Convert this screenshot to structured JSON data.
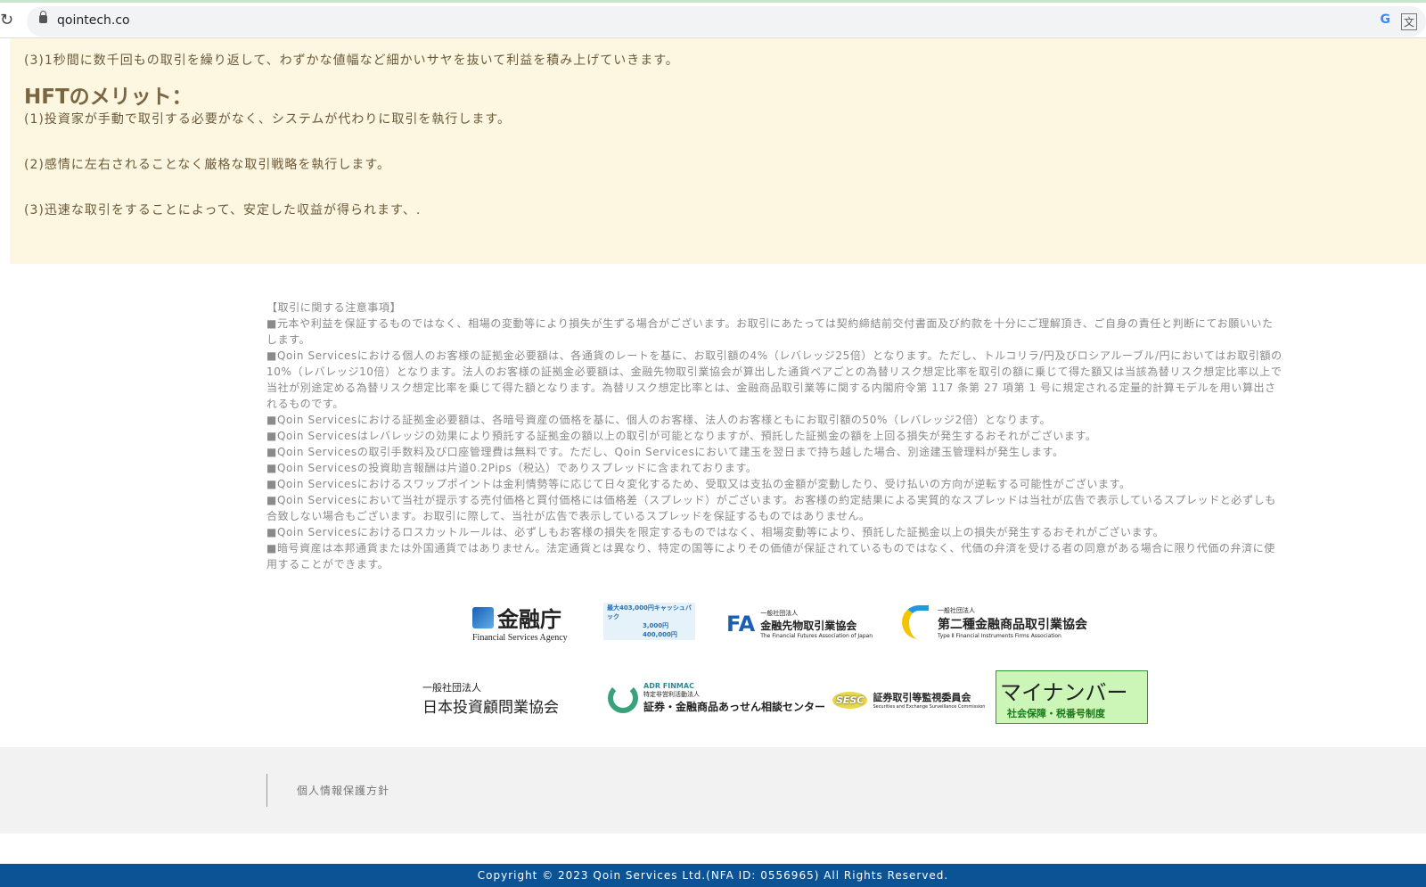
{
  "browser": {
    "url": "qointech.co"
  },
  "content": {
    "line_top": "(3)1秒間に数千回もの取引を繰り返して、わずかな値幅など細かいサヤを抜いて利益を積み上げていきます。",
    "heading": "HFTのメリット：",
    "merits": [
      "(1)投資家が手動で取引する必要がなく、システムが代わりに取引を執行します。",
      "(2)感情に左右されることなく厳格な取引戦略を執行します。",
      "(3)迅速な取引をすることによって、安定した収益が得られます、."
    ]
  },
  "notice": {
    "title": "【取引に関する注意事項】",
    "items": [
      "■元本や利益を保証するものではなく、相場の変動等により損失が生ずる場合がございます。お取引にあたっては契約締結前交付書面及び約款を十分にご理解頂き、ご自身の責任と判断にてお願いいたします。",
      "■Qoin Servicesにおける個人のお客様の証拠金必要額は、各通貨のレートを基に、お取引額の4%（レバレッジ25倍）となります。ただし、トルコリラ/円及びロシアルーブル/円においてはお取引額の10%（レバレッジ10倍）となります。法人のお客様の証拠金必要額は、金融先物取引業協会が算出した通貨ペアごとの為替リスク想定比率を取引の額に乗じて得た額又は当該為替リスク想定比率以上で当社が別途定める為替リスク想定比率を乗じて得た額となります。為替リスク想定比率とは、金融商品取引業等に関する内閣府令第 117 条第 27 項第 1 号に規定される定量的計算モデルを用い算出されるものです。",
      "■Qoin Servicesにおける証拠金必要額は、各暗号資産の価格を基に、個人のお客様、法人のお客様ともにお取引額の50%（レバレッジ2倍）となります。",
      "■Qoin Servicesはレバレッジの効果により預託する証拠金の額以上の取引が可能となりますが、預託した証拠金の額を上回る損失が発生するおそれがございます。",
      "■Qoin Servicesの取引手数料及び口座管理費は無料です。ただし、Qoin Servicesにおいて建玉を翌日まで持ち越した場合、別途建玉管理料が発生します。",
      "■Qoin Servicesの投資助言報酬は片道0.2Pips（税込）でありスプレッドに含まれております。",
      "■Qoin Servicesにおけるスワップポイントは金利情勢等に応じて日々変化するため、受取又は支払の金額が変動したり、受け払いの方向が逆転する可能性がございます。",
      "■Qoin Servicesにおいて当社が提示する売付価格と買付価格には価格差（スプレッド）がございます。お客様の約定結果による実質的なスプレッドは当社が広告で表示しているスプレッドと必ずしも合致しない場合もございます。お取引に際して、当社が広告で表示しているスプレッドを保証するものではありません。",
      "■Qoin Servicesにおけるロスカットルールは、必ずしもお客様の損失を限定するものではなく、相場変動等により、預託した証拠金以上の損失が発生するおそれがございます。",
      "■暗号資産は本邦通貨または外国通貨ではありません。法定通貨とは異なり、特定の国等によりその価値が保証されているものではなく、代価の弁済を受ける者の同意がある場合に限り代価の弁済に使用することができます。"
    ]
  },
  "logos": {
    "fsa": {
      "main": "金融庁",
      "sub": "Financial Services Agency"
    },
    "banner": {
      "top": "最大403,000円キャッシュバック",
      "a": "3,000円",
      "b": "400,000円"
    },
    "ffaj": {
      "small": "一般社団法人",
      "main": "金融先物取引業協会",
      "sub": "The Financial Futures Association of Japan"
    },
    "t2": {
      "small": "一般社団法人",
      "main": "第二種金融商品取引業協会",
      "sub": "Type Ⅱ Financial Instruments Firms Association"
    },
    "jiaa": {
      "small": "一般社団法人",
      "main": "日本投資顧問業協会"
    },
    "finmac": {
      "top": "ADR FINMAC",
      "small": "特定非営利活動法人",
      "main": "証券・金融商品あっせん相談センター"
    },
    "sesc": {
      "mark": "SESC",
      "main": "証券取引等監視委員会",
      "sub": "Securities and Exchange Surveillance Commission"
    },
    "mynumber": {
      "main": "マイナンバー",
      "sub": "社会保障・税番号制度"
    }
  },
  "footer": {
    "privacy": "個人情報保護方針",
    "copyright": "Copyright © 2023 Qoin Services Ltd.(NFA ID: 0556965) All Rights Reserved."
  }
}
